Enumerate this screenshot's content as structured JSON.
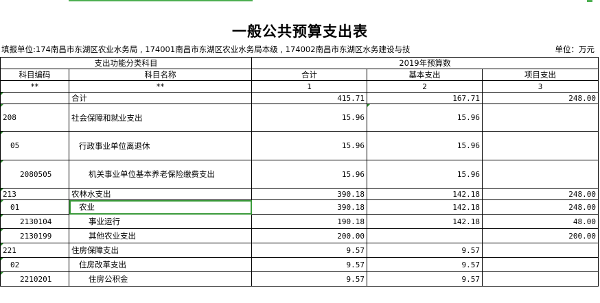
{
  "title": "一般公共预算支出表",
  "fill_unit": "填报单位:174南昌市东湖区农业水务局 , 174001南昌市东湖区农业水务局本级 , 174002南昌市东湖区水务建设与技",
  "unit": "单位：万元",
  "header": {
    "group_left": "支出功能分类科目",
    "group_right": "2019年预算数",
    "col_code": "科目编码",
    "col_name": "科目名称",
    "col_total": "合计",
    "col_basic": "基本支出",
    "col_project": "项目支出",
    "code_mark": "**",
    "name_mark": "**",
    "idx_total": "1",
    "idx_basic": "2",
    "idx_project": "3"
  },
  "rows": [
    {
      "code": "",
      "name": "合计",
      "total": "415.71",
      "basic": "167.71",
      "project": "248.00"
    },
    {
      "code": "208",
      "name": "社会保障和就业支出",
      "total": "15.96",
      "basic": "15.96",
      "project": ""
    },
    {
      "code": "05",
      "name": "行政事业单位离退休",
      "total": "15.96",
      "basic": "15.96",
      "project": ""
    },
    {
      "code": "2080505",
      "name": "机关事业单位基本养老保险缴费支出",
      "total": "15.96",
      "basic": "15.96",
      "project": ""
    },
    {
      "code": "213",
      "name": "农林水支出",
      "total": "390.18",
      "basic": "142.18",
      "project": "248.00"
    },
    {
      "code": "01",
      "name": "农业",
      "total": "390.18",
      "basic": "142.18",
      "project": "248.00"
    },
    {
      "code": "2130104",
      "name": "事业运行",
      "total": "190.18",
      "basic": "142.18",
      "project": "48.00"
    },
    {
      "code": "2130199",
      "name": "其他农业支出",
      "total": "200.00",
      "basic": "",
      "project": "200.00"
    },
    {
      "code": "221",
      "name": "住房保障支出",
      "total": "9.57",
      "basic": "9.57",
      "project": ""
    },
    {
      "code": "02",
      "name": "住房改革支出",
      "total": "9.57",
      "basic": "9.57",
      "project": ""
    },
    {
      "code": "2210201",
      "name": "住房公积金",
      "total": "9.57",
      "basic": "9.57",
      "project": ""
    }
  ]
}
